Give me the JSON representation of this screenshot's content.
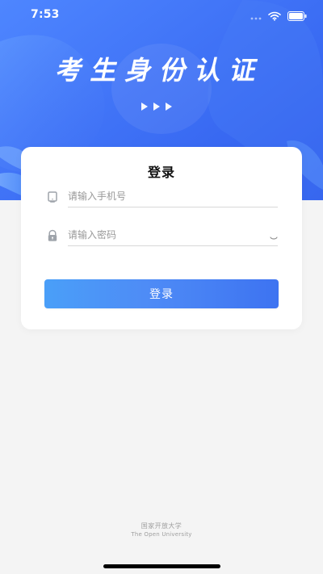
{
  "status_bar": {
    "time": "7:53"
  },
  "hero": {
    "title": "考生身份认证"
  },
  "login_card": {
    "title": "登录",
    "phone_placeholder": "请输入手机号",
    "password_placeholder": "请输入密码",
    "button_label": "登录"
  },
  "footer": {
    "org_cn": "国家开放大学",
    "org_en": "The Open University"
  },
  "icons": {
    "signal": "cellular-dots-icon",
    "wifi": "wifi-icon",
    "battery": "battery-icon",
    "arrows": "play-arrow-icon",
    "phone": "phone-icon",
    "lock": "lock-icon",
    "visibility": "eye-closed-icon"
  },
  "colors": {
    "hero_primary": "#2f6cff",
    "button_start": "#4a9ff8",
    "button_end": "#3d73f1",
    "background": "#f4f4f4"
  }
}
